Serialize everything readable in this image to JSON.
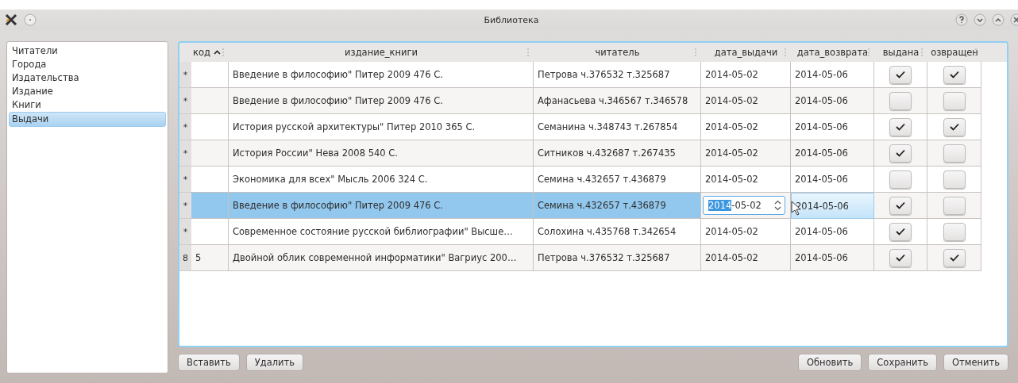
{
  "window": {
    "title": "Библиотека"
  },
  "sidebar": {
    "items": [
      {
        "label": "Читатели",
        "selected": false
      },
      {
        "label": "Города",
        "selected": false
      },
      {
        "label": "Издательства",
        "selected": false
      },
      {
        "label": "Издание",
        "selected": false
      },
      {
        "label": "Книги",
        "selected": false
      },
      {
        "label": "Выдачи",
        "selected": true
      }
    ]
  },
  "table": {
    "columns": [
      {
        "label": "код",
        "sort_ascending": true
      },
      {
        "label": "издание_книги"
      },
      {
        "label": "читатель"
      },
      {
        "label": "дата_выдачи"
      },
      {
        "label": "дата_возврата"
      },
      {
        "label": "выдана"
      },
      {
        "label": "озвращен"
      }
    ],
    "rows": [
      {
        "header": "*",
        "code": "",
        "edition": "Введение в философию\" Питер 2009 476 С.",
        "reader": "Петрова ч.376532 т.325687",
        "issue_date": "2014-05-02",
        "return_date": "2014-05-06",
        "issued": true,
        "returned": true,
        "selected": false
      },
      {
        "header": "*",
        "code": "",
        "edition": "Введение в философию\" Питер 2009 476 С.",
        "reader": "Афанасьева ч.346567 т.346578",
        "issue_date": "2014-05-02",
        "return_date": "2014-05-06",
        "issued": false,
        "returned": false,
        "selected": false
      },
      {
        "header": "*",
        "code": "",
        "edition": "История русской архитектуры\" Питер 2010 365 С.",
        "reader": "Семанина ч.348743 т.267854",
        "issue_date": "2014-05-02",
        "return_date": "2014-05-06",
        "issued": true,
        "returned": true,
        "selected": false
      },
      {
        "header": "*",
        "code": "",
        "edition": "История России\" Нева 2008 540 С.",
        "reader": "Ситников ч.432687 т.267435",
        "issue_date": "2014-05-02",
        "return_date": "2014-05-06",
        "issued": true,
        "returned": false,
        "selected": false
      },
      {
        "header": "*",
        "code": "",
        "edition": "Экономика для всех\" Мысль 2006 324 С.",
        "reader": "Семина ч.432657 т.436879",
        "issue_date": "2014-05-02",
        "return_date": "2014-05-06",
        "issued": false,
        "returned": false,
        "selected": false
      },
      {
        "header": "*",
        "code": "",
        "edition": "Введение в философию\" Питер 2009 476 С.",
        "reader": "Семина ч.432657 т.436879",
        "editor": {
          "selected_part": "2014",
          "rest": "-05-02"
        },
        "return_date": "2014-05-06",
        "return_hovered": true,
        "issued": true,
        "returned": false,
        "selected": true
      },
      {
        "header": "*",
        "code": "",
        "edition": "Современное состояние русской библиографии\" Высше…",
        "reader": "Солохина ч.435768 т.342654",
        "issue_date": "2014-05-02",
        "return_date": "2014-05-06",
        "issued": true,
        "returned": false,
        "selected": false
      },
      {
        "header": "8",
        "code": "5",
        "edition": "Двойной облик современной информатики\" Вагриус 200…",
        "reader": "Петрова ч.376532 т.325687",
        "issue_date": "2014-05-02",
        "return_date": "2014-05-06",
        "issued": true,
        "returned": true,
        "selected": false
      }
    ]
  },
  "buttons_left": [
    "Вставить",
    "Удалить"
  ],
  "buttons_right": [
    "Обновить",
    "Сохранить",
    "Отменить"
  ]
}
